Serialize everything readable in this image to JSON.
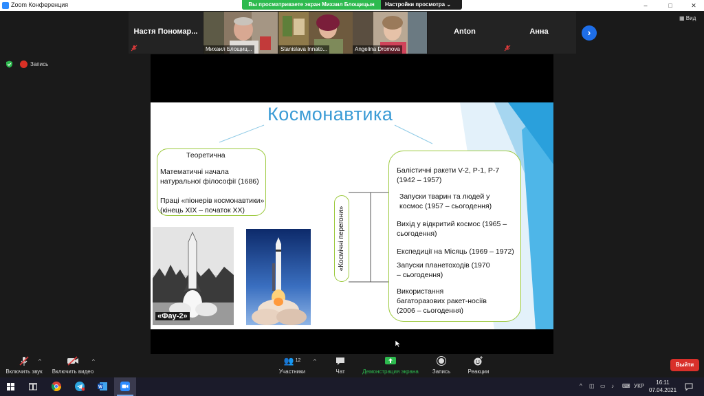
{
  "window": {
    "title": "Zoom Конференция",
    "controls": [
      "–",
      "□",
      "✕"
    ]
  },
  "share_banner": {
    "text": "Вы просматриваете экран Михаил Блощицын",
    "options": "Настройки просмотра"
  },
  "participants": [
    {
      "display_name": "Настя  Пономар...",
      "video": false,
      "muted": true
    },
    {
      "label": "Михаил Блощиц...",
      "video": true,
      "muted": false
    },
    {
      "label": "Stanislava Innato...",
      "video": true,
      "muted": false
    },
    {
      "label": "Angelina Dromova",
      "video": true,
      "muted": false
    },
    {
      "display_name": "Anton",
      "video": false,
      "muted": false
    },
    {
      "display_name": "Анна",
      "video": false,
      "muted": true
    }
  ],
  "view_button": "Вид",
  "recording_label": "Запись",
  "slide": {
    "title": "Космонавтика",
    "theory_header": "Теоретична",
    "theory_item1": [
      "Математичні начала",
      "натуральної філософії (1686)"
    ],
    "theory_item2": [
      "Праці «піонерів космонавтики»",
      "(кінець XIX – початок XX)"
    ],
    "vertical_label": "«Космічні перегони»",
    "photo1_caption": "«Фау-2»",
    "events": [
      [
        "Балістичні ракети V-2, Р-1, Р-7",
        "(1942 – 1957)"
      ],
      [
        "Запуски тварин та людей у",
        "космос (1957 – сьогодення)"
      ],
      [
        "Вихід у відкритий космос (1965 –",
        "сьогодення)"
      ],
      [
        "Експедиції на Місяць (1969 – 1972)"
      ],
      [
        "Запуски планетоходів (1970",
        "– сьогодення)"
      ],
      [
        "Використання",
        "багаторазових ракет-носіїв",
        "(2006 – сьогодення)"
      ]
    ]
  },
  "toolbar": {
    "audio": "Включить звук",
    "video": "Включить видео",
    "participants": "Участники",
    "participants_count": "12",
    "chat": "Чат",
    "share": "Демонстрация экрана",
    "record": "Запись",
    "reactions": "Реакции",
    "exit": "Выйти"
  },
  "taskbar": {
    "lang": "УКР",
    "time": "16:11",
    "date": "07.04.2021"
  },
  "colors": {
    "accent_green": "#2dba4e",
    "slide_title": "#3a9bd5",
    "box_border": "#9bc93c",
    "exit_red": "#d9302a"
  }
}
